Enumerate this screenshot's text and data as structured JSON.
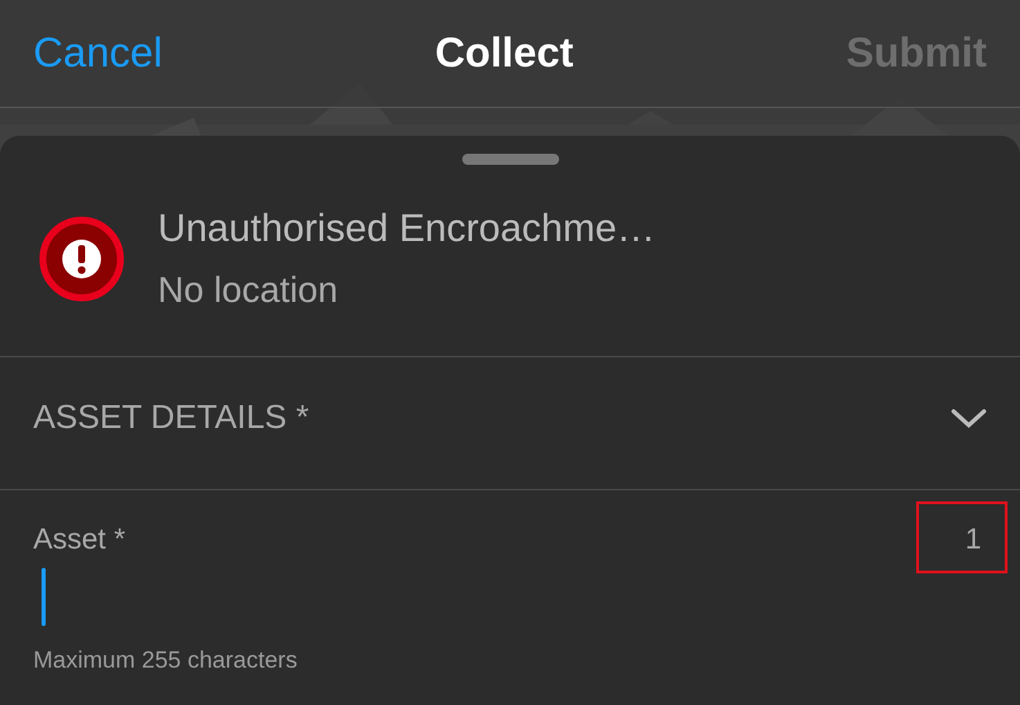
{
  "nav_bar": {
    "cancel": "Cancel",
    "title": "Collect",
    "submit": "Submit",
    "submit_disabled": true
  },
  "feature": {
    "title": "Unauthorised Encroachme…",
    "subtitle": "No location"
  },
  "section": {
    "title": "ASSET DETAILS *",
    "expanded": true
  },
  "field": {
    "label": "Asset *",
    "counter": "1",
    "focused": true,
    "hint": "Maximum 255 characters",
    "highlighted": true
  }
}
